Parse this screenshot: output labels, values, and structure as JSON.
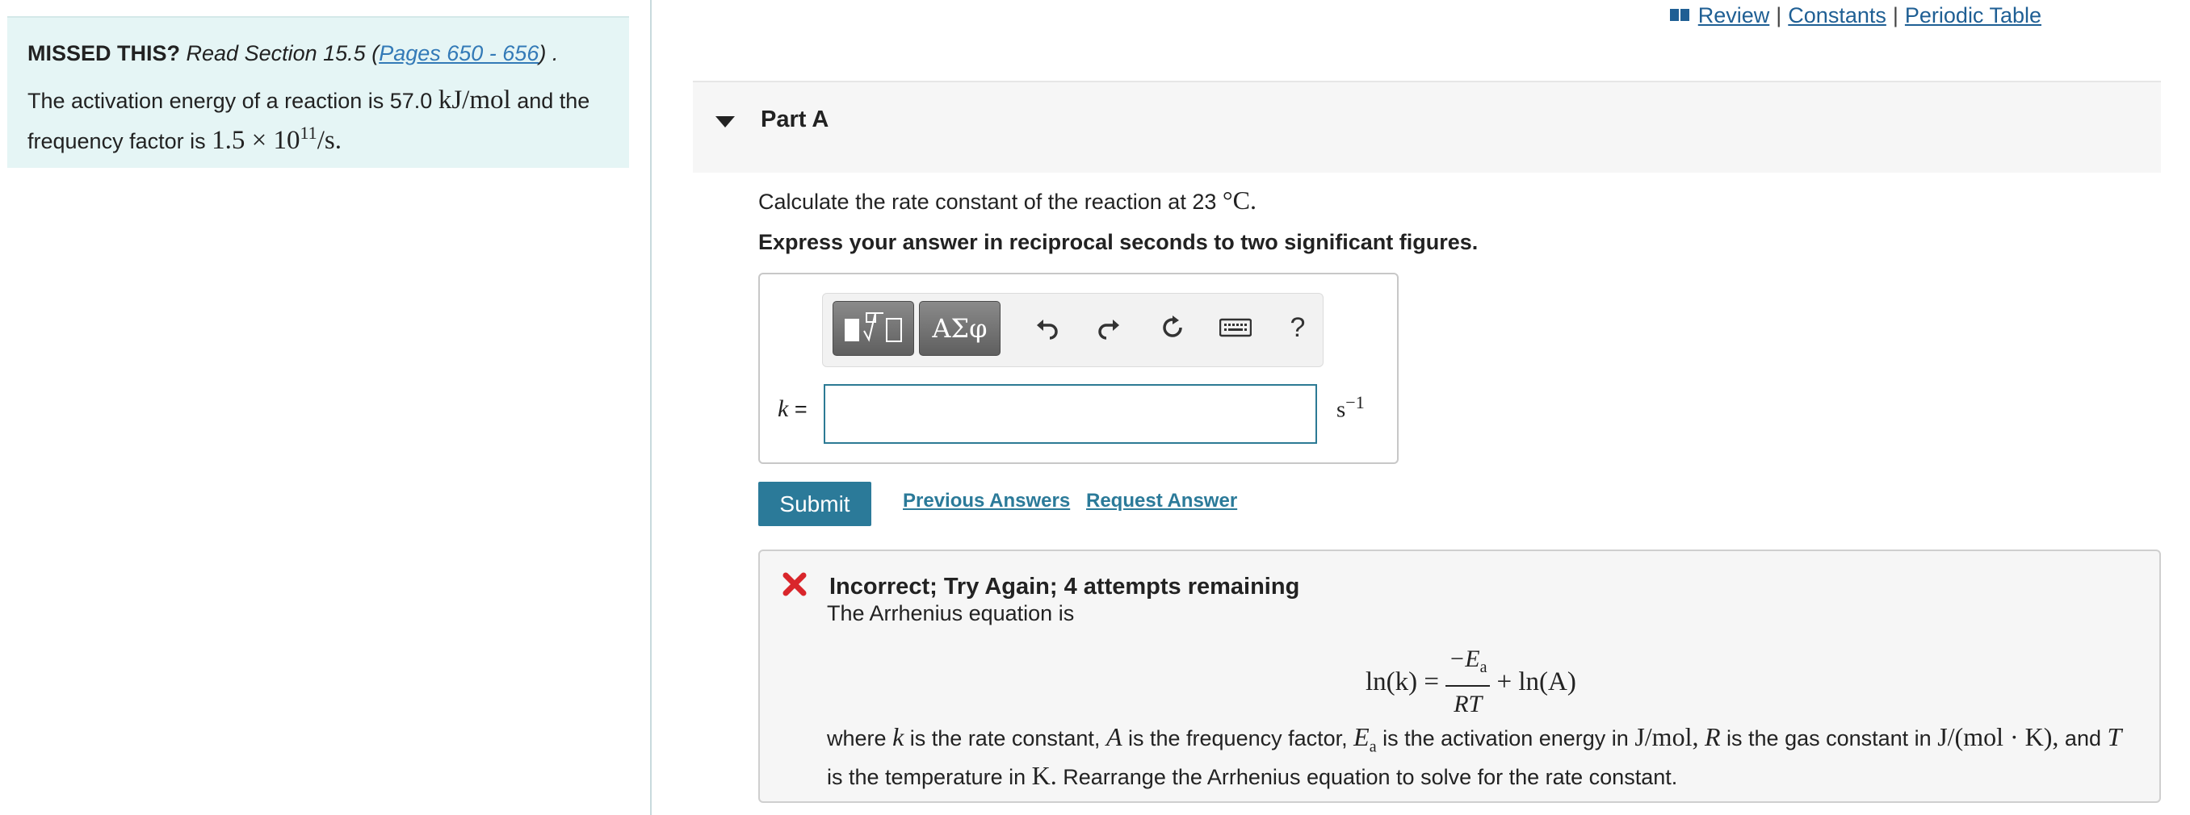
{
  "left_panel": {
    "missed_label": "MISSED THIS?",
    "read_section": "Read Section 15.5 (",
    "pages_link": "Pages 650 - 656",
    "read_end": ") .",
    "problem_text_1": "The activation energy of a reaction is 57.0",
    "activation_unit": "kJ/mol",
    "problem_text_2": "and the frequency factor is",
    "frequency_value": "1.5 × 10",
    "frequency_exp": "11",
    "frequency_unit": "/s."
  },
  "top_links": {
    "review": "Review",
    "constants": "Constants",
    "periodic_table": "Periodic Table",
    "separator": "|"
  },
  "part": {
    "title": "Part A"
  },
  "question": {
    "text": "Calculate the rate constant of the reaction at 23",
    "temp_unit": "°C.",
    "instruction": "Express your answer in reciprocal seconds to two significant figures."
  },
  "answer": {
    "variable": "k",
    "equals": " =",
    "value": "",
    "unit": "s",
    "unit_exp": "−1",
    "toolbar": {
      "greek_label": "ΑΣφ",
      "help_label": "?"
    }
  },
  "actions": {
    "submit": "Submit",
    "previous_answers": "Previous Answers",
    "request_answer": "Request Answer"
  },
  "feedback": {
    "title": "Incorrect; Try Again; 4 attempts remaining",
    "line1": "The Arrhenius equation is",
    "eq_lhs": "ln(k) =",
    "eq_num": "−E",
    "eq_num_sub": "a",
    "eq_den": "RT",
    "eq_rhs": "+ ln(A)",
    "p_where": "where",
    "p_k": "k",
    "p_is_rate": "is the rate constant,",
    "p_A": "A",
    "p_is_freq": "is the frequency factor,",
    "p_E": "E",
    "p_E_sub": "a",
    "p_is_act": "is the activation energy in",
    "p_unit1": "J/mol,",
    "p_R": "R",
    "p_is_gas": "is the gas constant in",
    "p_unit2": "J/(mol · K),",
    "p_and": "and",
    "p_T": "T",
    "p_is_temp": "is the temperature in",
    "p_K": "K.",
    "p_end": "Rearrange the Arrhenius equation to solve for the rate constant."
  },
  "colors": {
    "accent": "#2b7a99",
    "link": "#1f5f94",
    "panel_bg": "#e5f5f5",
    "error": "#d9262b"
  }
}
